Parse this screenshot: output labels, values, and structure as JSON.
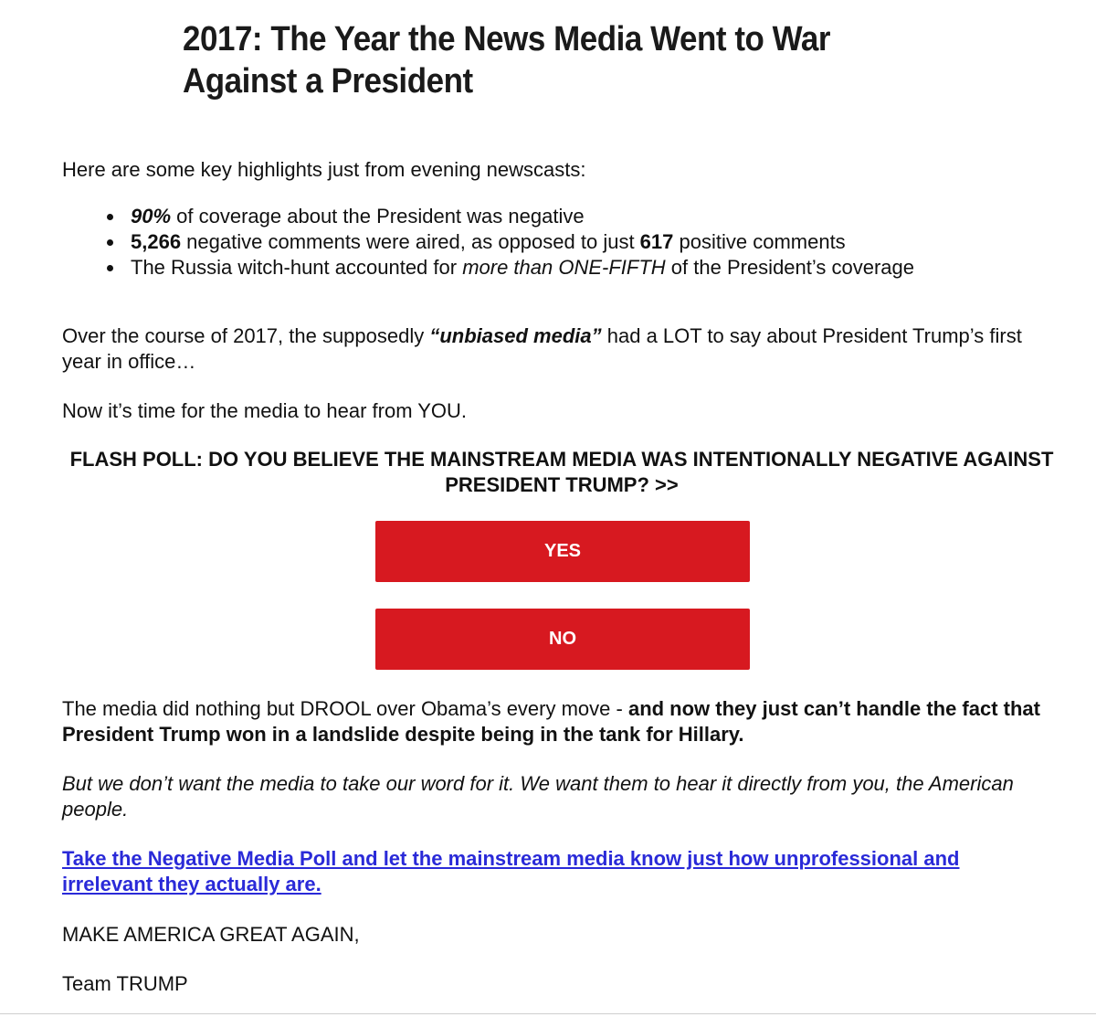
{
  "headline": "2017: The Year the News Media Went to War Against a President",
  "intro": "Here are some key highlights just from evening newscasts:",
  "bullets": {
    "b1": {
      "strong": "90%",
      "rest": " of coverage about the President was negative"
    },
    "b2": {
      "num1": "5,266",
      "mid": " negative comments were aired, as opposed to just ",
      "num2": "617",
      "end": " positive comments"
    },
    "b3": {
      "pre": "The Russia witch-hunt accounted for ",
      "em": "more than ONE-FIFTH",
      "post": " of the President’s coverage"
    }
  },
  "over": {
    "pre": "Over the course of 2017, the supposedly ",
    "emph": "“unbiased media”",
    "post": " had a LOT to say about President Trump’s first year in office…"
  },
  "now_text": "Now it’s time for the media to hear from YOU.",
  "poll_question": "FLASH POLL: DO YOU BELIEVE THE MAINSTREAM MEDIA WAS INTENTIONALLY NEGATIVE AGAINST PRESIDENT TRUMP? >>",
  "buttons": {
    "yes": "YES",
    "no": "NO"
  },
  "media_drool": {
    "pre": "The media did nothing but DROOL over Obama’s every move - ",
    "bold": "and now they just can’t handle the fact that President Trump won in a landslide despite being in the tank for Hillary."
  },
  "italic_para": "But we don’t want the media to take our word for it. We want them to hear it directly from you, the American people.",
  "poll_link": "Take the Negative Media Poll and let the mainstream media know just how unprofessional and irrelevant they actually are.",
  "signoff": "MAKE AMERICA GREAT AGAIN,",
  "team": "Team TRUMP",
  "colors": {
    "button_red": "#d71920",
    "link_blue": "#2a2ad8"
  }
}
